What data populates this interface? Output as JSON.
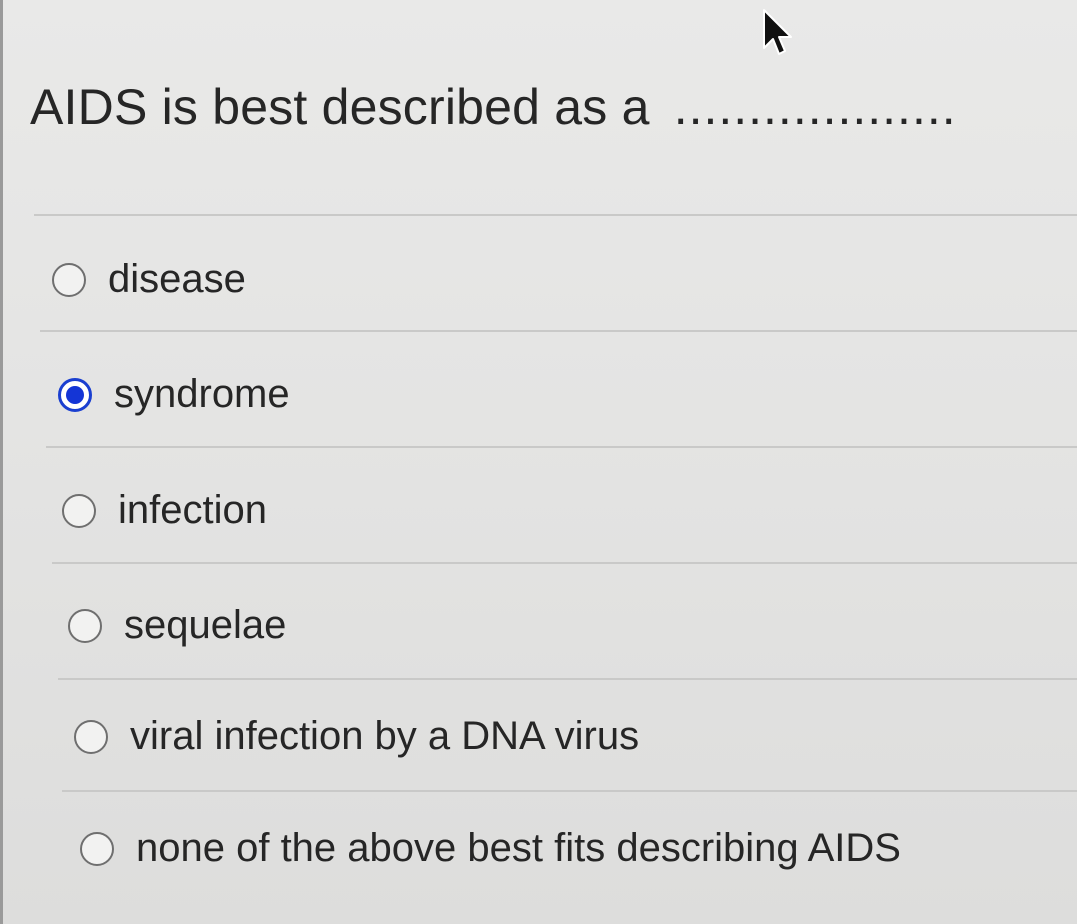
{
  "question": {
    "text": "AIDS is best described as a",
    "blank": "..................."
  },
  "options": [
    {
      "label": "disease",
      "selected": false
    },
    {
      "label": "syndrome",
      "selected": true
    },
    {
      "label": "infection",
      "selected": false
    },
    {
      "label": "sequelae",
      "selected": false
    },
    {
      "label": "viral infection by a DNA virus",
      "selected": false
    },
    {
      "label": "none of the above best fits describing AIDS",
      "selected": false
    }
  ],
  "colors": {
    "selected_radio": "#1435d6",
    "background": "#e5e5e4",
    "text": "#262626"
  },
  "icons": {
    "cursor": "mouse-pointer-arrow"
  }
}
